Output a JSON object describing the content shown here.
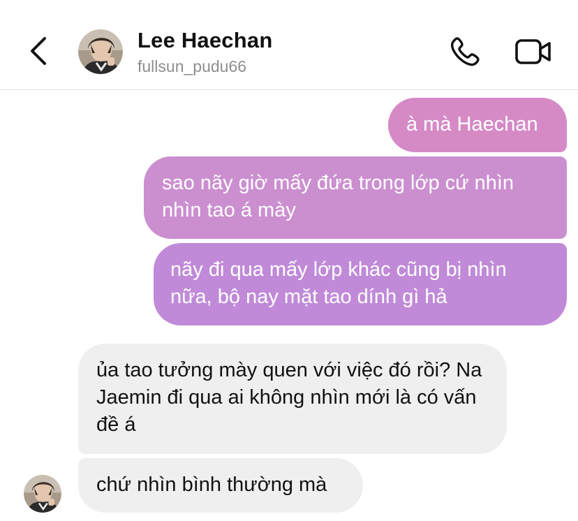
{
  "header": {
    "name": "Lee Haechan",
    "handle": "fullsun_pudu66",
    "icons": {
      "back": "chevron-left-icon",
      "call": "phone-icon",
      "video": "video-camera-icon"
    }
  },
  "messages": [
    {
      "direction": "outgoing",
      "text": "à mà Haechan"
    },
    {
      "direction": "outgoing",
      "text": "sao nãy giờ mấy đứa trong lớp cứ nhìn nhìn tao á mày"
    },
    {
      "direction": "outgoing",
      "text": "nãy đi qua mấy lớp khác cũng bị nhìn nữa, bộ nay mặt tao dính gì hả"
    },
    {
      "direction": "incoming",
      "text": "ủa tao tưởng mày quen với việc đó rồi? Na Jaemin đi qua ai không nhìn mới là có vấn đề á"
    },
    {
      "direction": "incoming",
      "text": "chứ nhìn bình thường mà"
    }
  ],
  "colors": {
    "outgoing_top": "#d58ac6",
    "outgoing_mid": "#cb8fd0",
    "outgoing_bottom": "#c08ad8",
    "incoming": "#efefef",
    "handle_text": "#8e8e8e"
  }
}
